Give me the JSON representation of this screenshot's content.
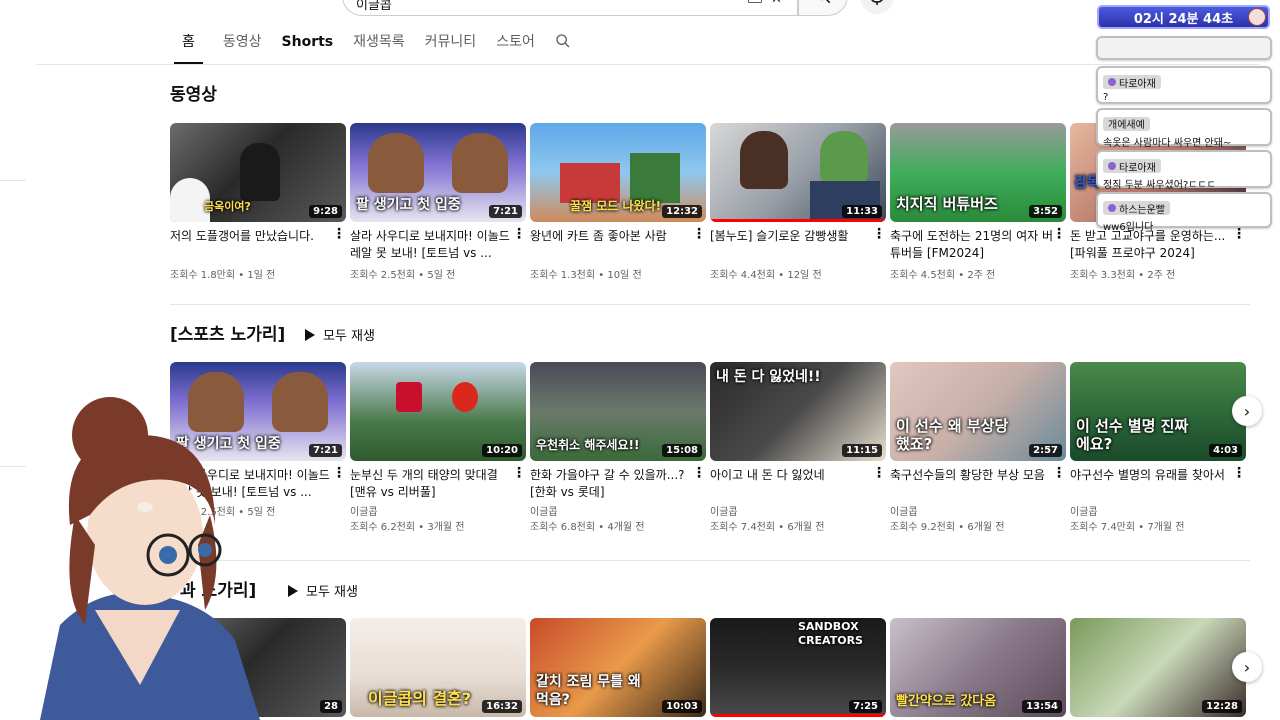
{
  "search": {
    "query": "이글콥"
  },
  "tabs": [
    {
      "label": "홈",
      "active": true
    },
    {
      "label": "동영상"
    },
    {
      "label": "Shorts"
    },
    {
      "label": "재생목록"
    },
    {
      "label": "커뮤니티"
    },
    {
      "label": "스토어"
    }
  ],
  "sections": [
    {
      "title": "동영상",
      "videos": [
        {
          "thumb_text": "금옥이여?",
          "duration": "9:28",
          "title": "저의 도플갱어를 만났습니다.",
          "meta": "조회수 1.8만회 • 1일 전"
        },
        {
          "thumb_text": "팔 생기고 첫 입중",
          "duration": "7:21",
          "title": "살라 사우디로 보내지마! 이놀드 레알 못 보내! [토트넘 vs ...",
          "meta": "조회수 2.5천회 • 5일 전"
        },
        {
          "thumb_text": "꿀잼 모드 나왔다!",
          "duration": "12:32",
          "title": "왕년에 카트 좀 좋아본 사람",
          "meta": "조회수 1.3천회 • 10일 전"
        },
        {
          "thumb_text": "",
          "duration": "11:33",
          "title": "[봄누도] 슬기로운 감빵생활",
          "meta": "조회수 4.4천회 • 12일 전"
        },
        {
          "thumb_text": "치지직 버튜버즈",
          "duration": "3:52",
          "title": "축구에 도전하는 21명의 여자 버튜버들 [FM2024]",
          "meta": "조회수 4.5천회 • 2주 전"
        },
        {
          "thumb_text": "감독 아",
          "duration": "",
          "title": "돈 받고 고교야구를 운영하는... [파워풀 프로야구 2024]",
          "meta": "조회수 3.3천회 • 2주 전"
        }
      ]
    },
    {
      "title": "[스포츠 노가리]",
      "play_all": "모두 재생",
      "videos": [
        {
          "thumb_text": "팔 생기고 첫 입중",
          "duration": "7:21",
          "title": "살라 사우디로 보내지마! 이놀드 레알 못 보내! [토트넘 vs ...",
          "channel": "",
          "meta": "조회수 2.5천회 • 5일 전"
        },
        {
          "thumb_text": "",
          "duration": "10:20",
          "title": "눈부신 두 개의 태양의 맞대결 [맨유 vs 리버풀]",
          "channel": "이글콥",
          "meta": "조회수 6.2천회 • 3개월 전"
        },
        {
          "thumb_text": "우천취소 해주세요!!",
          "duration": "15:08",
          "title": "한화 가을야구 갈 수 있을까...? [한화 vs 롯데]",
          "channel": "이글콥",
          "meta": "조회수 6.8천회 • 4개월 전"
        },
        {
          "thumb_text": "내 돈 다 잃었네!!",
          "duration": "11:15",
          "title": "아이고 내 돈 다 잃었네",
          "channel": "이글콥",
          "meta": "조회수 7.4천회 • 6개월 전"
        },
        {
          "thumb_text": "이 선수 왜 부상당했죠?",
          "duration": "2:57",
          "title": "축구선수들의 황당한 부상 모음",
          "channel": "이글콥",
          "meta": "조회수 9.2천회 • 6개월 전"
        },
        {
          "thumb_text": "이 선수 별명 진짜에요?",
          "duration": "4:03",
          "title": "야구선수 별명의 유래를 찾아서",
          "channel": "이글콥",
          "meta": "조회수 7.4만회 • 7개월 전"
        }
      ]
    },
    {
      "title": "과 노가리]",
      "play_all": "모두 재생",
      "videos": [
        {
          "thumb_text": "",
          "duration": "28",
          "title": "",
          "meta": ""
        },
        {
          "thumb_text": "이글콥의 결혼?",
          "duration": "16:32",
          "title": "",
          "meta": ""
        },
        {
          "thumb_text": "갈치 조림 무를 왜 먹음?",
          "duration": "10:03",
          "title": "",
          "meta": ""
        },
        {
          "thumb_text": "SANDBOX CREATORS",
          "duration": "7:25",
          "title": "",
          "meta": ""
        },
        {
          "thumb_text": "빨간약으로 갔다옴",
          "duration": "13:54",
          "title": "",
          "meta": ""
        },
        {
          "thumb_text": "",
          "duration": "12:28",
          "title": "",
          "meta": ""
        }
      ]
    }
  ],
  "overlay": {
    "timer": "02시 24분 44초",
    "chats": [
      {
        "name": "타로아재",
        "msg": "?"
      },
      {
        "name": "개에새예",
        "msg": "속옷은 사람마다 싸우면 안돼~"
      },
      {
        "name": "타로아재",
        "msg": "정직 두분 싸우셨어?ㄷㄷㄷ"
      },
      {
        "name": "하스는운빨",
        "msg": "ww6입니다"
      }
    ]
  },
  "colors": {
    "accent": "#ff0000",
    "text": "#0f0f0f",
    "meta": "#606060",
    "timer": "#3a44c8"
  }
}
